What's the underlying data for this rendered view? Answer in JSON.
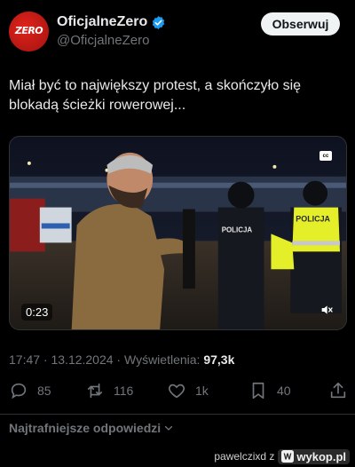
{
  "header": {
    "display_name": "OficjalneZero",
    "handle": "@OficjalneZero",
    "avatar_text": "ZERO",
    "follow_label": "Obserwuj"
  },
  "tweet": {
    "text": "Miał być to największy protest, a skończyło się blokadą ścieżki rowerowej..."
  },
  "media": {
    "duration": "0:23",
    "cc_label": "cc",
    "vest_text": "POLICJA",
    "jacket_text": "POLICJA"
  },
  "meta": {
    "time_date": "17:47 · 13.12.2024 · Wyświetlenia: ",
    "views": "97,3k"
  },
  "actions": {
    "replies": "85",
    "reposts": "116",
    "likes": "1k",
    "bookmarks": "40"
  },
  "replies_sort": {
    "label": "Najtrafniejsze odpowiedzi"
  },
  "watermark": {
    "user": "pawelczixd z",
    "site": "wykop.pl"
  },
  "colors": {
    "background": "#000000",
    "text": "#e7e9ea",
    "muted": "#71767b",
    "verified": "#1d9bf0",
    "avatar": "#d71e1a",
    "vest": "#e4ef2a"
  }
}
